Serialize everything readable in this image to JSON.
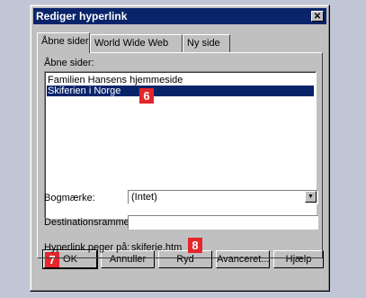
{
  "dialog": {
    "title": "Rediger hyperlink",
    "close_glyph": "✕"
  },
  "tabs": [
    {
      "label": "Åbne sider"
    },
    {
      "label": "World Wide Web"
    },
    {
      "label": "Ny side"
    }
  ],
  "open_pages": {
    "label": "Åbne sider:",
    "items": [
      {
        "label": "Familien Hansens hjemmeside"
      },
      {
        "label": "Skiferien i Norge"
      }
    ]
  },
  "bookmark": {
    "label": "Bogmærke:",
    "value": "(Intet)"
  },
  "destination_frame": {
    "label": "Destinationsramme:",
    "value": ""
  },
  "hyperlink_target": {
    "label": "Hyperlink peger på:",
    "value": "skiferie.htm"
  },
  "buttons": {
    "ok": "OK",
    "cancel": "Annuller",
    "clear": "Ryd",
    "advanced": "Avanceret...",
    "help": "Hjælp"
  },
  "callouts": {
    "list": "6",
    "ok": "7",
    "target": "8"
  },
  "colors": {
    "callout": "#e5262a",
    "selection": "#0a246a",
    "background": "#c1c6d6"
  }
}
